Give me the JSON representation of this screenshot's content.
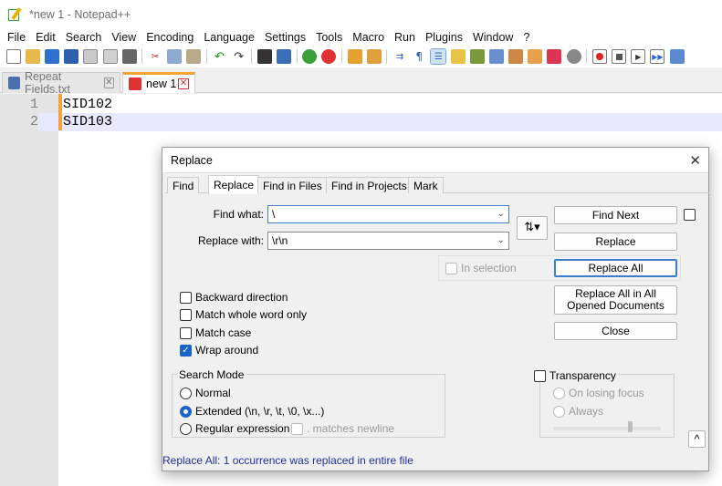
{
  "window": {
    "title": "*new 1 - Notepad++"
  },
  "menu": [
    "File",
    "Edit",
    "Search",
    "View",
    "Encoding",
    "Language",
    "Settings",
    "Tools",
    "Macro",
    "Run",
    "Plugins",
    "Window",
    "?"
  ],
  "tabs": [
    {
      "label": "Repeat Fields.txt",
      "active": false
    },
    {
      "label": "new 1",
      "active": true
    }
  ],
  "editor": {
    "lines": [
      {
        "num": "1",
        "text": "SID102"
      },
      {
        "num": "2",
        "text": "SID103"
      }
    ]
  },
  "dialog": {
    "title": "Replace",
    "close_icon": "✕",
    "tabs": [
      "Find",
      "Replace",
      "Find in Files",
      "Find in Projects",
      "Mark"
    ],
    "active_tab": "Replace",
    "find_what_label": "Find what:",
    "find_what_value": "\\",
    "replace_with_label": "Replace with:",
    "replace_with_value": "\\r\\n",
    "swap_label": "⇅▾",
    "buttons": {
      "find_next": "Find Next",
      "replace": "Replace",
      "replace_all": "Replace All",
      "replace_all_opened": "Replace All in All Opened Documents",
      "close": "Close"
    },
    "in_selection": "In selection",
    "options": [
      {
        "label": "Backward direction",
        "checked": false
      },
      {
        "label": "Match whole word only",
        "checked": false
      },
      {
        "label": "Match case",
        "checked": false
      },
      {
        "label": "Wrap around",
        "checked": true
      }
    ],
    "search_mode": {
      "title": "Search Mode",
      "modes": [
        {
          "label": "Normal",
          "selected": false
        },
        {
          "label": "Extended (\\n, \\r, \\t, \\0, \\x...)",
          "selected": true
        },
        {
          "label": "Regular expression",
          "selected": false
        }
      ],
      "matches_newline": ". matches newline"
    },
    "transparency": {
      "title": "Transparency",
      "on_losing_focus": "On losing focus",
      "always": "Always"
    },
    "up_button": "^",
    "status": "Replace All: 1 occurrence was replaced in entire file"
  }
}
